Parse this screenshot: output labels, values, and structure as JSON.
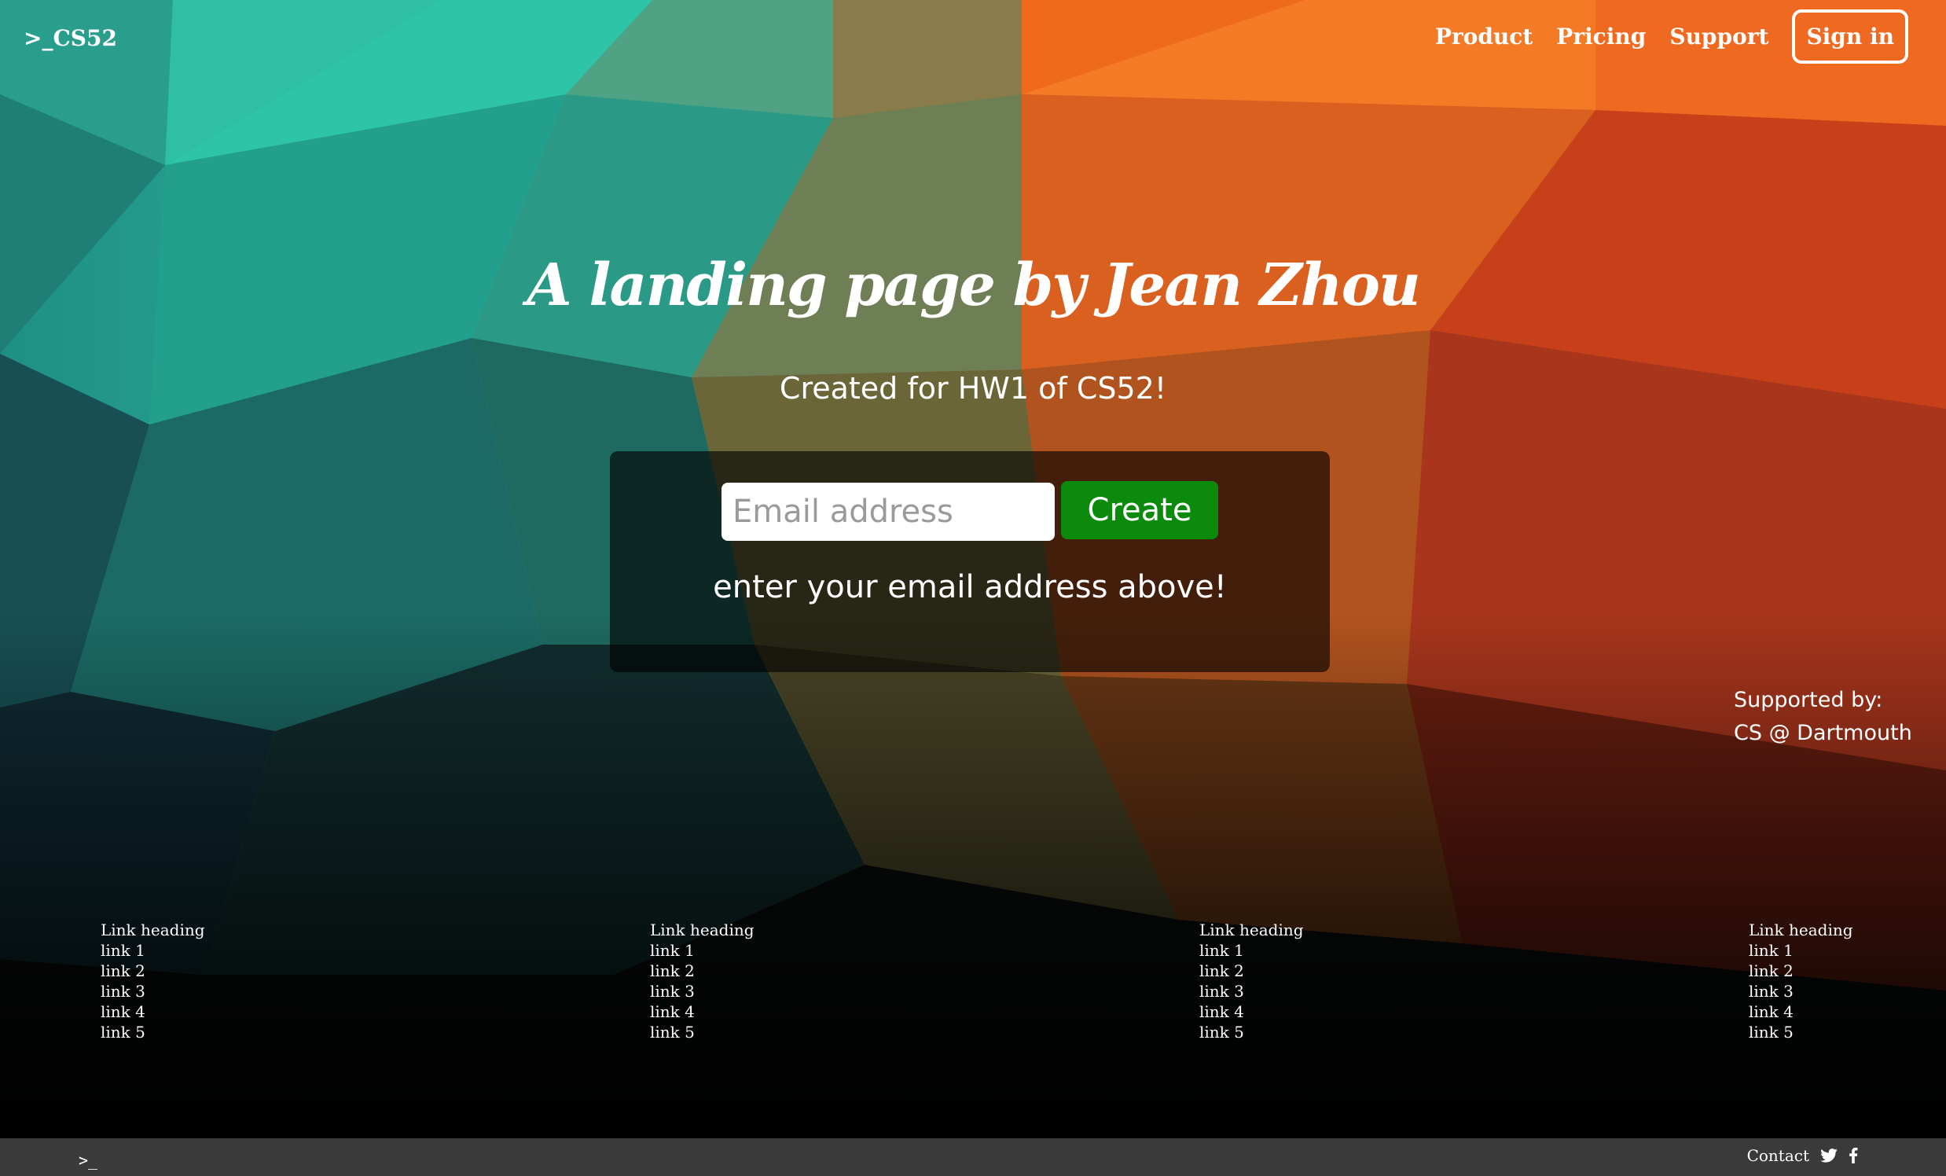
{
  "nav": {
    "brand": ">_CS52",
    "links": [
      "Product",
      "Pricing",
      "Support"
    ],
    "signin": "Sign in"
  },
  "hero": {
    "title": "A landing page by Jean Zhou",
    "subtitle": "Created for HW1 of CS52!"
  },
  "signup": {
    "email_placeholder": "Email address",
    "email_value": "",
    "button": "Create",
    "hint": "enter your email address above!"
  },
  "support": {
    "label": "Supported by:",
    "name": "CS @ Dartmouth"
  },
  "link_columns": [
    {
      "heading": "Link heading",
      "links": [
        "link 1",
        "link 2",
        "link 3",
        "link 4",
        "link 5"
      ]
    },
    {
      "heading": "Link heading",
      "links": [
        "link 1",
        "link 2",
        "link 3",
        "link 4",
        "link 5"
      ]
    },
    {
      "heading": "Link heading",
      "links": [
        "link 1",
        "link 2",
        "link 3",
        "link 4",
        "link 5"
      ]
    },
    {
      "heading": "Link heading",
      "links": [
        "link 1",
        "link 2",
        "link 3",
        "link 4",
        "link 5"
      ]
    }
  ],
  "footer": {
    "brand": ">_",
    "contact": "Contact",
    "icons": [
      "twitter-icon",
      "facebook-icon"
    ]
  },
  "colors": {
    "create_button": "#0b8a0b",
    "footer_bar": "#3a3a3a",
    "teal": "#2cc3a6",
    "orange": "#f4661c"
  }
}
